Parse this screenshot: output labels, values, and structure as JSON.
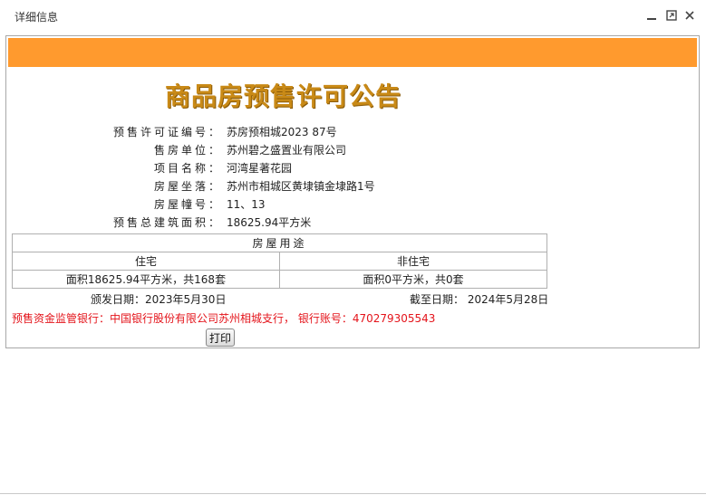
{
  "window": {
    "title": "详细信息",
    "controls": [
      "minimize-icon",
      "maximize-icon",
      "close-icon"
    ]
  },
  "notice": {
    "heading": "商品房预售许可公告",
    "fields": [
      {
        "label": "预售许可证编号：",
        "value": "苏房预相城2023 87号"
      },
      {
        "label": "售房单位：",
        "value": "苏州碧之盛置业有限公司"
      },
      {
        "label": "项目名称：",
        "value": "河湾星著花园"
      },
      {
        "label": "房屋坐落：",
        "value": "苏州市相城区黄埭镇金埭路1号"
      },
      {
        "label": "房屋幢号：",
        "value": "11、13"
      },
      {
        "label": "预售总建筑面积：",
        "value": "18625.94平方米"
      }
    ],
    "usage_table": {
      "header": "房屋用途",
      "columns": [
        "住宅",
        "非住宅"
      ],
      "values": [
        "面积18625.94平方米，共168套",
        "面积0平方米，共0套"
      ]
    },
    "issue_date": "颁发日期：2023年5月30日",
    "expire_date": "截至日期：  2024年5月28日",
    "bank_info": "预售资金监管银行：中国银行股份有限公司苏州相城支行，  银行账号：470279305543",
    "print_label": "打印"
  },
  "colors": {
    "banner": "#ff9a2e",
    "heading": "#c98a17",
    "bank_text": "#e4141b"
  }
}
